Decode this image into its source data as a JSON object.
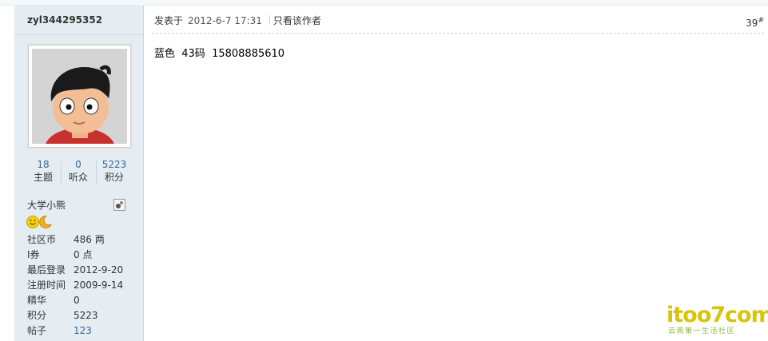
{
  "author": {
    "username": "zyl344295352",
    "stats": [
      {
        "value": "18",
        "label": "主题"
      },
      {
        "value": "0",
        "label": "听众"
      },
      {
        "value": "5223",
        "label": "积分"
      }
    ],
    "group": "大学小熊",
    "details": [
      {
        "key": "社区币",
        "value": "486 两"
      },
      {
        "key": "I券",
        "value": "0 点"
      },
      {
        "key": "最后登录",
        "value": "2012-9-20"
      },
      {
        "key": "注册时间",
        "value": "2009-9-14"
      },
      {
        "key": "精华",
        "value": "0"
      },
      {
        "key": "积分",
        "value": "5223"
      },
      {
        "key": "帖子",
        "value": "123"
      }
    ]
  },
  "post": {
    "posted_label": "发表于",
    "date": "2012-6-7 17:31",
    "only_author_label": "只看该作者",
    "floor": "39",
    "floor_mark": "#",
    "content": "蓝色  43码  15808885610"
  },
  "watermark": {
    "logo": "itoo7com",
    "tagline": "云南第一生活社区"
  },
  "colors": {
    "sidebar_bg": "#e5edf2",
    "link": "#336699",
    "border": "#c2d5e3"
  }
}
